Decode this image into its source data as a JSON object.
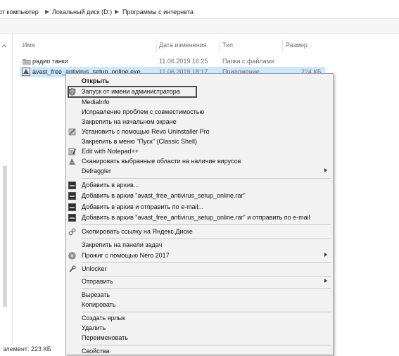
{
  "breadcrumb": {
    "items": [
      "от компьютер",
      "Локальный диск (D:)",
      "Программы с интернета"
    ]
  },
  "columns": {
    "name": "Имя",
    "date": "Дата изменения",
    "type": "Тип",
    "size": "Размер"
  },
  "files": [
    {
      "name": "радио танки",
      "date": "11.06.2019 16:25",
      "type": "Папка с файлами",
      "size": "",
      "icon": "folder-icon",
      "selected": false
    },
    {
      "name": "avast_free_antivirus_setup_online.exe",
      "date": "11.06.2019 18:17",
      "type": "Приложение",
      "size": "224 КБ",
      "icon": "avast-app-icon",
      "selected": true
    }
  ],
  "status": {
    "text": "элемент: 223 КБ"
  },
  "context_menu": {
    "items": [
      {
        "label": "Открыть",
        "bold": true,
        "icon": "",
        "submenu": false
      },
      {
        "label": "Запуск от имени администратора",
        "icon": "shield-icon",
        "submenu": false,
        "highlighted": true
      },
      {
        "label": "MediaInfo",
        "icon": "",
        "submenu": false
      },
      {
        "label": "Исправление проблем с совместимостью",
        "icon": "",
        "submenu": false
      },
      {
        "label": "Закрепить на начальном экране",
        "icon": "",
        "submenu": false
      },
      {
        "label": "Установить с помощью Revo Uninstaller Pro",
        "icon": "revo-icon",
        "submenu": false
      },
      {
        "label": "Закрепить в меню \"Пуск\" (Classic Shell)",
        "icon": "",
        "submenu": false
      },
      {
        "label": "Edit with Notepad++",
        "icon": "notepad-icon",
        "submenu": false
      },
      {
        "label": "Сканировать выбранные области на наличие вирусов",
        "icon": "scan-icon",
        "submenu": false
      },
      {
        "label": "Defraggler",
        "icon": "",
        "submenu": true
      },
      {
        "label": "Добавить в архив...",
        "icon": "archive-icon",
        "submenu": false
      },
      {
        "label": "Добавить в архив \"avast_free_antivirus_setup_online.rar\"",
        "icon": "archive-icon",
        "submenu": false
      },
      {
        "label": "Добавить в архив и отправить по e-mail...",
        "icon": "archive-icon",
        "submenu": false
      },
      {
        "label": "Добавить в архив \"avast_free_antivirus_setup_online.rar\" и отправить по e-mail",
        "icon": "archive-icon",
        "submenu": false
      },
      {
        "label": "Скопировать ссылку на Яндекс.Диске",
        "icon": "link-icon",
        "submenu": false
      },
      {
        "label": "Закрепить на панели задач",
        "icon": "",
        "submenu": false
      },
      {
        "label": "Прожиг с помощью Nero 2017",
        "icon": "nero-icon",
        "submenu": true
      },
      {
        "label": "Unlocker",
        "icon": "unlocker-icon",
        "submenu": false
      },
      {
        "label": "Отправить",
        "icon": "",
        "submenu": true
      },
      {
        "label": "Вырезать",
        "icon": "",
        "submenu": false
      },
      {
        "label": "Копировать",
        "icon": "",
        "submenu": false
      },
      {
        "label": "Создать ярлык",
        "icon": "",
        "submenu": false
      },
      {
        "label": "Удалить",
        "icon": "",
        "submenu": false
      },
      {
        "label": "Переименовать",
        "icon": "",
        "submenu": false
      },
      {
        "label": "Свойства",
        "icon": "",
        "submenu": false
      }
    ]
  }
}
